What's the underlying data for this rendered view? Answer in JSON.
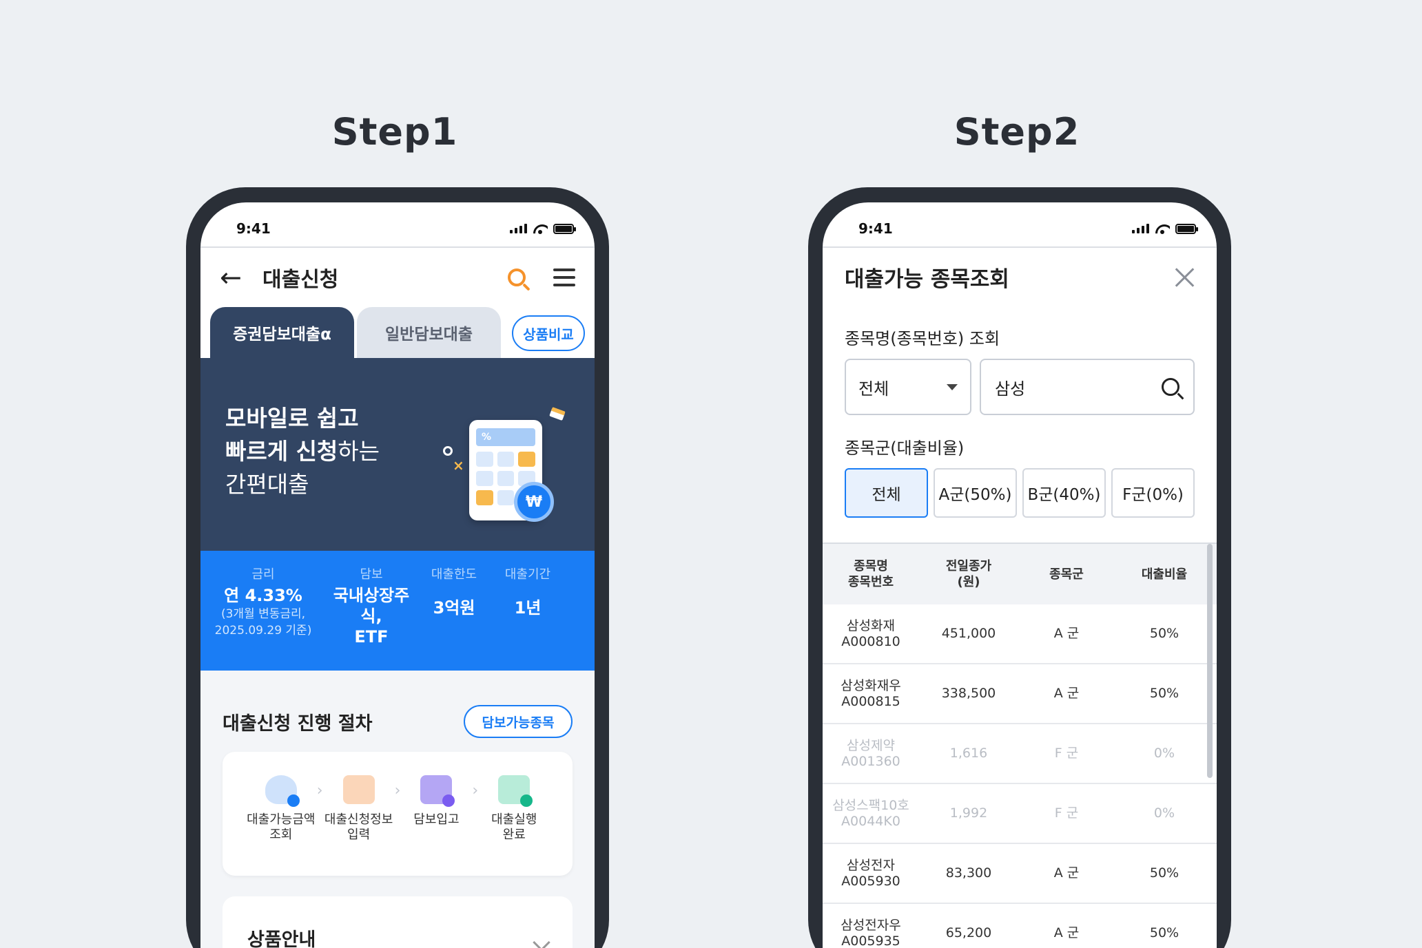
{
  "step1": {
    "heading": "Step1",
    "status": {
      "time": "9:41"
    },
    "header": {
      "title": "대출신청"
    },
    "tabs": [
      {
        "label": "증권담보대출α",
        "active": true
      },
      {
        "label": "일반담보대출",
        "active": false
      }
    ],
    "compare_label": "상품비교",
    "banner": {
      "line1": "모바일로 쉽고",
      "line2_bold": "빠르게 신청",
      "line2_rest": "하는",
      "line3": "간편대출",
      "won_symbol": "₩"
    },
    "info": [
      {
        "label": "금리",
        "value": "연 4.33%",
        "sub1": "(3개월 변동금리,",
        "sub2": "2025.09.29 기준)"
      },
      {
        "label": "담보",
        "value1": "국내상장주식,",
        "value2": "ETF"
      },
      {
        "label": "대출한도",
        "value": "3억원"
      },
      {
        "label": "대출기간",
        "value": "1년"
      }
    ],
    "process": {
      "title": "대출신청 진행 절차",
      "pledge_label": "담보가능종목",
      "steps": [
        {
          "line1": "대출가능금액",
          "line2": "조회",
          "icon": "money-bag-icon"
        },
        {
          "line1": "대출신청정보",
          "line2": "입력",
          "icon": "clipboard-icon"
        },
        {
          "line1": "담보입고",
          "line2": "",
          "icon": "store-icon"
        },
        {
          "line1": "대출실행",
          "line2": "완료",
          "icon": "document-check-icon"
        }
      ]
    },
    "product": {
      "title": "상품안내"
    }
  },
  "step2": {
    "heading": "Step2",
    "status": {
      "time": "9:41"
    },
    "modal_title": "대출가능 종목조회",
    "search_label": "종목명(종목번호) 조회",
    "select_value": "전체",
    "search_value": "삼성",
    "group_label": "종목군(대출비율)",
    "chips": [
      {
        "label": "전체",
        "selected": true
      },
      {
        "label": "A군(50%)",
        "selected": false
      },
      {
        "label": "B군(40%)",
        "selected": false
      },
      {
        "label": "F군(0%)",
        "selected": false
      }
    ],
    "table": {
      "headers": [
        {
          "l1": "종목명",
          "l2": "종목번호"
        },
        {
          "l1": "전일종가",
          "l2": "(원)"
        },
        {
          "l1": "종목군",
          "l2": ""
        },
        {
          "l1": "대출비율",
          "l2": ""
        }
      ],
      "rows": [
        {
          "name": "삼성화재",
          "code": "A000810",
          "price": "451,000",
          "group": "A 군",
          "ratio": "50%",
          "dim": false
        },
        {
          "name": "삼성화재우",
          "code": "A000815",
          "price": "338,500",
          "group": "A 군",
          "ratio": "50%",
          "dim": false
        },
        {
          "name": "삼성제약",
          "code": "A001360",
          "price": "1,616",
          "group": "F 군",
          "ratio": "0%",
          "dim": true
        },
        {
          "name": "삼성스팩10호",
          "code": "A0044K0",
          "price": "1,992",
          "group": "F 군",
          "ratio": "0%",
          "dim": true
        },
        {
          "name": "삼성전자",
          "code": "A005930",
          "price": "83,300",
          "group": "A 군",
          "ratio": "50%",
          "dim": false
        },
        {
          "name": "삼성전자우",
          "code": "A005935",
          "price": "65,200",
          "group": "A 군",
          "ratio": "50%",
          "dim": false
        }
      ]
    }
  }
}
